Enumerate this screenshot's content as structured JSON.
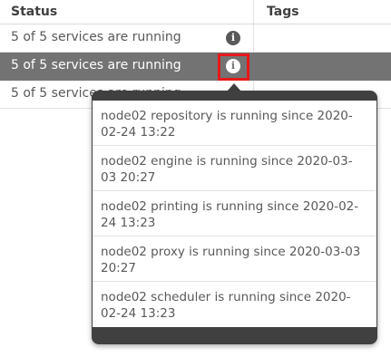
{
  "table": {
    "headers": {
      "status": "Status",
      "tags": "Tags"
    },
    "rows": [
      {
        "status": "5 of 5 services are running",
        "selected": false
      },
      {
        "status": "5 of 5 services are running",
        "selected": true
      },
      {
        "status": "5 of 5 services are running",
        "selected": false
      }
    ],
    "info_icon_glyph": "i"
  },
  "popover": {
    "items": [
      "node02 repository is running since 2020-02-24 13:22",
      "node02 engine is running since 2020-03-03 20:27",
      "node02 printing is running since 2020-02-24 13:23",
      "node02 proxy is running since 2020-03-03 20:27",
      "node02 scheduler is running since 2020-02-24 13:23"
    ]
  },
  "colors": {
    "selected_row": "#737373",
    "popover_frame": "#404040",
    "highlight": "#e61919"
  }
}
